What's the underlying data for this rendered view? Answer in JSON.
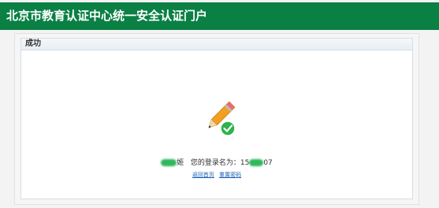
{
  "header": {
    "title": "北京市教育认证中心统一安全认证门户"
  },
  "panel": {
    "title": "成功"
  },
  "status": {
    "name_suffix": "姬",
    "login_label": "您的登录名为：",
    "login_prefix": "15",
    "login_suffix": "07"
  },
  "links": {
    "home": "返回首页",
    "reset": "重置密码"
  },
  "colors": {
    "header_bg": "#0a8044",
    "check_badge": "#2db34a",
    "link": "#1a5fb4"
  }
}
